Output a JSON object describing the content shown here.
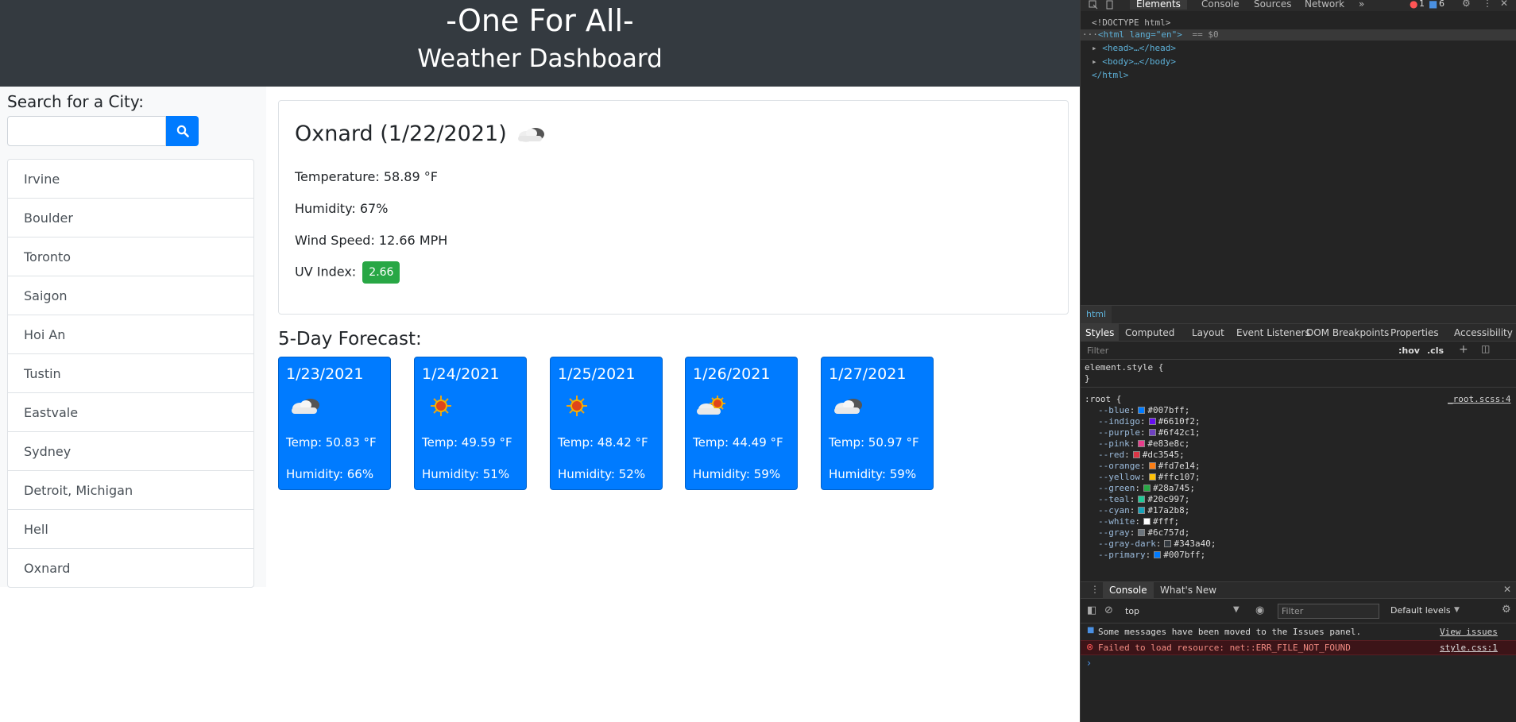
{
  "header": {
    "title": "-One For All-",
    "subtitle": "Weather Dashboard"
  },
  "search": {
    "label": "Search for a City:",
    "placeholder": "",
    "value": ""
  },
  "cities": [
    "Irvine",
    "Boulder",
    "Toronto",
    "Saigon",
    "Hoi An",
    "Tustin",
    "Eastvale",
    "Sydney",
    "Detroit, Michigan",
    "Hell",
    "Oxnard"
  ],
  "current": {
    "title": "Oxnard (1/22/2021)",
    "icon": "cloud-icon",
    "temperature": "Temperature: 58.89 °F",
    "humidity": "Humidity: 67%",
    "wind": "Wind Speed: 12.66 MPH",
    "uv_label": "UV Index:",
    "uv_value": "2.66",
    "uv_color": "#28a745"
  },
  "forecast": {
    "title": "5-Day Forecast:",
    "days": [
      {
        "date": "1/23/2021",
        "icon": "cloud-icon",
        "temp": "Temp: 50.83 °F",
        "humidity": "Humidity: 66%"
      },
      {
        "date": "1/24/2021",
        "icon": "sun-icon",
        "temp": "Temp: 49.59 °F",
        "humidity": "Humidity: 51%"
      },
      {
        "date": "1/25/2021",
        "icon": "sun-icon",
        "temp": "Temp: 48.42 °F",
        "humidity": "Humidity: 52%"
      },
      {
        "date": "1/26/2021",
        "icon": "partly-cloudy-icon",
        "temp": "Temp: 44.49 °F",
        "humidity": "Humidity: 59%"
      },
      {
        "date": "1/27/2021",
        "icon": "cloud-icon",
        "temp": "Temp: 50.97 °F",
        "humidity": "Humidity: 59%"
      }
    ]
  },
  "colors": {
    "header_bg": "#343a40",
    "primary": "#007bff",
    "sidebar_bg": "#f8f9fa",
    "success": "#28a745"
  },
  "devtools": {
    "tabs": [
      "Elements",
      "Console",
      "Sources",
      "Network"
    ],
    "more": "»",
    "errors": "1",
    "issues": "6",
    "dom": {
      "doctype": "<!DOCTYPE html>",
      "html_open": "<html lang=\"en\">",
      "selected_marker": "== $0",
      "head": "<head>…</head>",
      "body": "<body>…</body>",
      "html_close": "</html>"
    },
    "crumb": "html",
    "styles_tabs": [
      "Styles",
      "Computed",
      "Layout",
      "Event Listeners",
      "DOM Breakpoints",
      "Properties",
      "Accessibility"
    ],
    "filter_placeholder": "Filter",
    "hov": ":hov",
    "cls": ".cls",
    "element_style": "element.style {",
    "element_style_close": "}",
    "root_selector": ":root {",
    "root_source": "_root.scss:4",
    "vars": [
      {
        "name": "--blue",
        "value": "#007bff"
      },
      {
        "name": "--indigo",
        "value": "#6610f2"
      },
      {
        "name": "--purple",
        "value": "#6f42c1"
      },
      {
        "name": "--pink",
        "value": "#e83e8c"
      },
      {
        "name": "--red",
        "value": "#dc3545"
      },
      {
        "name": "--orange",
        "value": "#fd7e14"
      },
      {
        "name": "--yellow",
        "value": "#ffc107"
      },
      {
        "name": "--green",
        "value": "#28a745"
      },
      {
        "name": "--teal",
        "value": "#20c997"
      },
      {
        "name": "--cyan",
        "value": "#17a2b8"
      },
      {
        "name": "--white",
        "value": "#fff"
      },
      {
        "name": "--gray",
        "value": "#6c757d"
      },
      {
        "name": "--gray-dark",
        "value": "#343a40"
      },
      {
        "name": "--primary",
        "value": "#007bff"
      }
    ],
    "console_tabs": [
      "Console",
      "What's New"
    ],
    "context": "top",
    "console_filter": "Filter",
    "levels": "Default levels",
    "messages": [
      {
        "text": "Some messages have been moved to the Issues panel.",
        "link": "View issues",
        "type": "info"
      },
      {
        "text": "Failed to load resource: net::ERR_FILE_NOT_FOUND",
        "link": "style.css:1",
        "type": "error"
      }
    ],
    "prompt": "›"
  }
}
